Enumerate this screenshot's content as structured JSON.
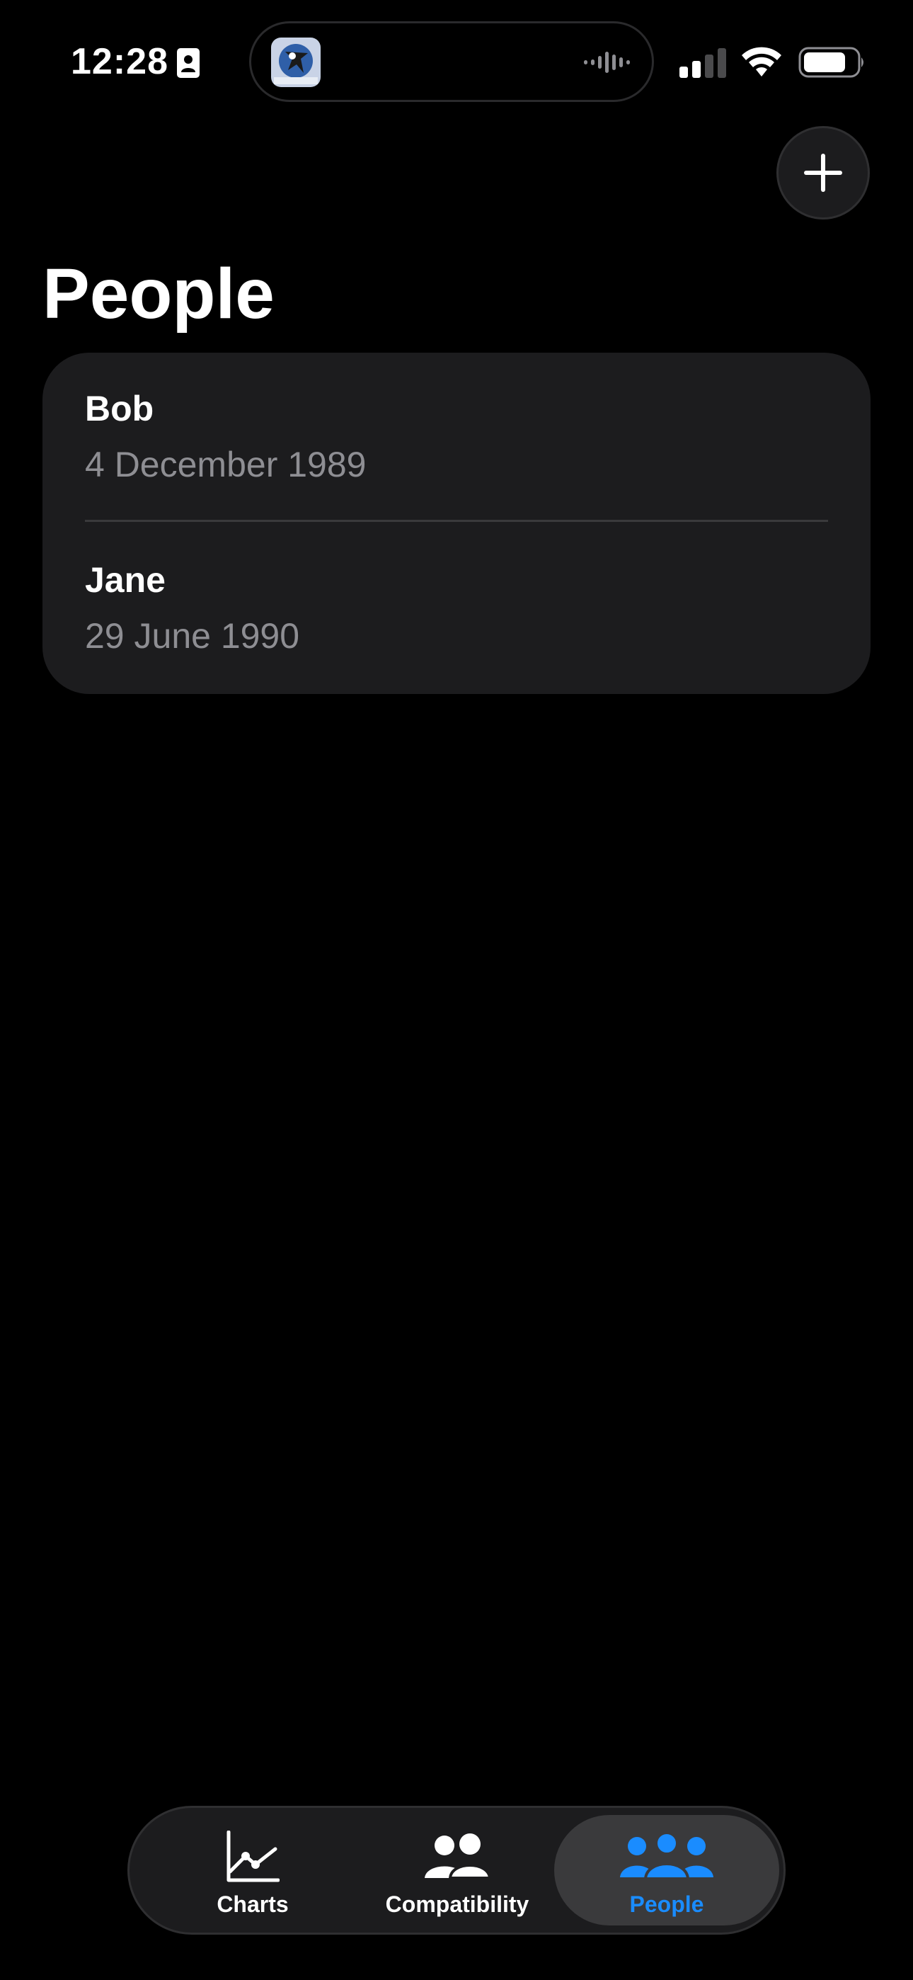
{
  "status_bar": {
    "time": "12:28",
    "icons": [
      "contact-card-icon",
      "app-activity-icon",
      "audio-wave-icon",
      "cellular-signal-icon",
      "wifi-icon",
      "battery-icon"
    ]
  },
  "header": {
    "title": "People",
    "add_icon": "plus-icon"
  },
  "people": [
    {
      "name": "Bob",
      "birth_date": "4 December 1989"
    },
    {
      "name": "Jane",
      "birth_date": "29 June 1990"
    }
  ],
  "tab_bar": {
    "tabs": [
      {
        "label": "Charts",
        "icon": "line-chart-icon",
        "selected": false
      },
      {
        "label": "Compatibility",
        "icon": "two-people-icon",
        "selected": false
      },
      {
        "label": "People",
        "icon": "three-people-icon",
        "selected": true
      }
    ]
  },
  "colors": {
    "background": "#000000",
    "card": "#1c1c1e",
    "secondary_text": "#8e8e93",
    "accent": "#1a8cff",
    "selected_tab": "#3a3a3c"
  }
}
